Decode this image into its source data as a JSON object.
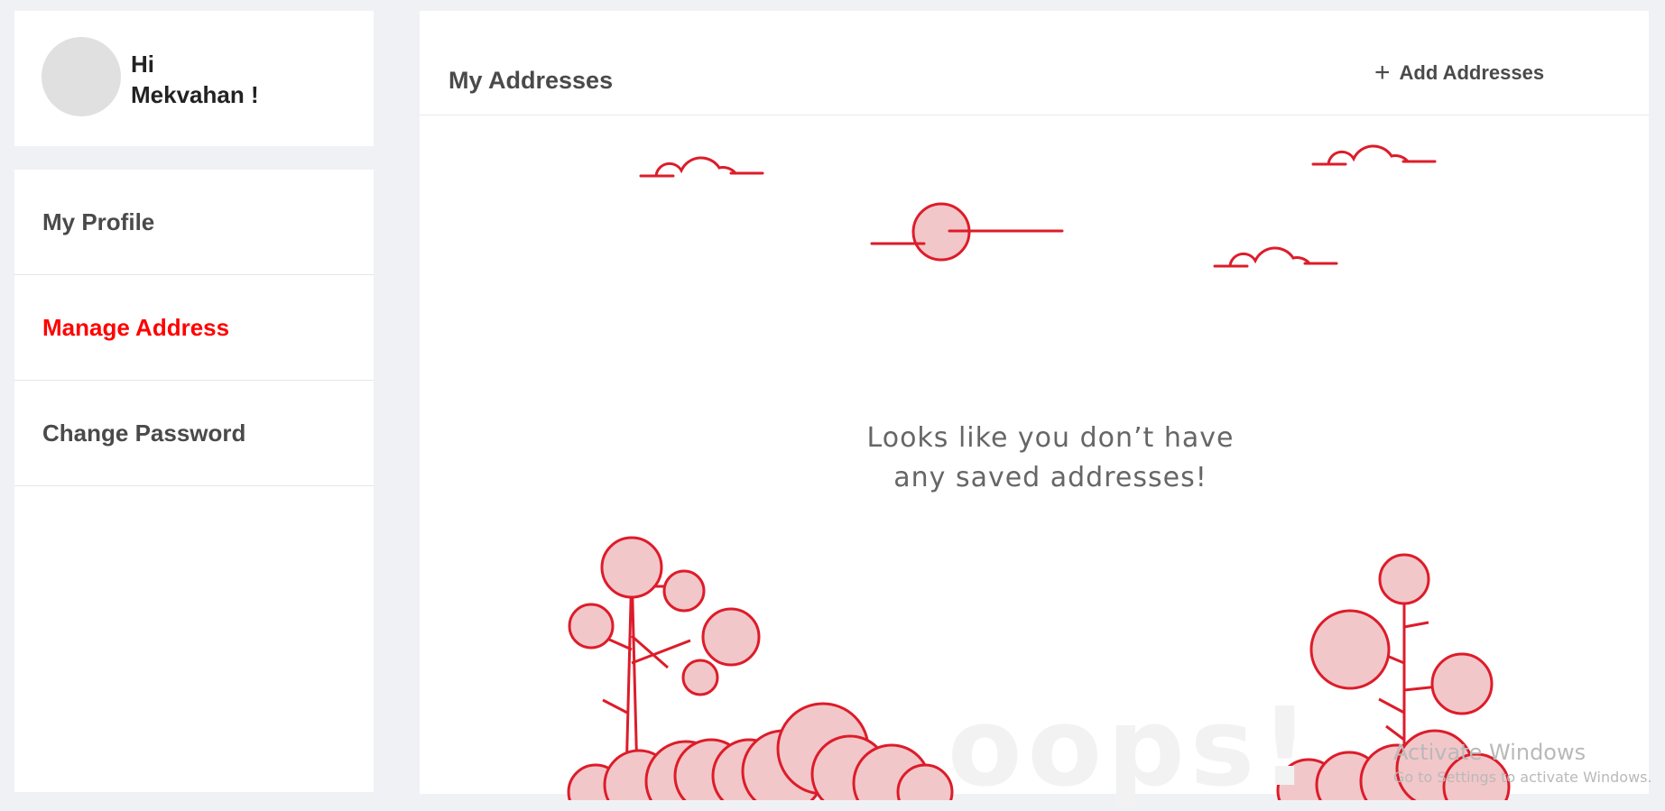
{
  "profile": {
    "greeting_line1": "Hi",
    "greeting_line2": "Mekvahan !"
  },
  "sidebar": {
    "items": [
      {
        "label": "My Profile",
        "active": false
      },
      {
        "label": "Manage Address",
        "active": true
      },
      {
        "label": "Change Password",
        "active": false
      }
    ]
  },
  "main": {
    "title": "My Addresses",
    "add_button": {
      "icon": "plus-icon",
      "label": "Add Addresses"
    },
    "empty_state": {
      "line1": "Looks like you don’t have",
      "line2": "any saved addresses!",
      "watermark": "oops!"
    }
  },
  "os_watermark": {
    "line1": "Activate Windows",
    "line2": "Go to Settings to activate Windows."
  },
  "colors": {
    "accent": "#ff0000",
    "illustration_stroke": "#dd1c2a",
    "illustration_fill": "#f2c7c9",
    "page_bg": "#f0f1f5"
  }
}
